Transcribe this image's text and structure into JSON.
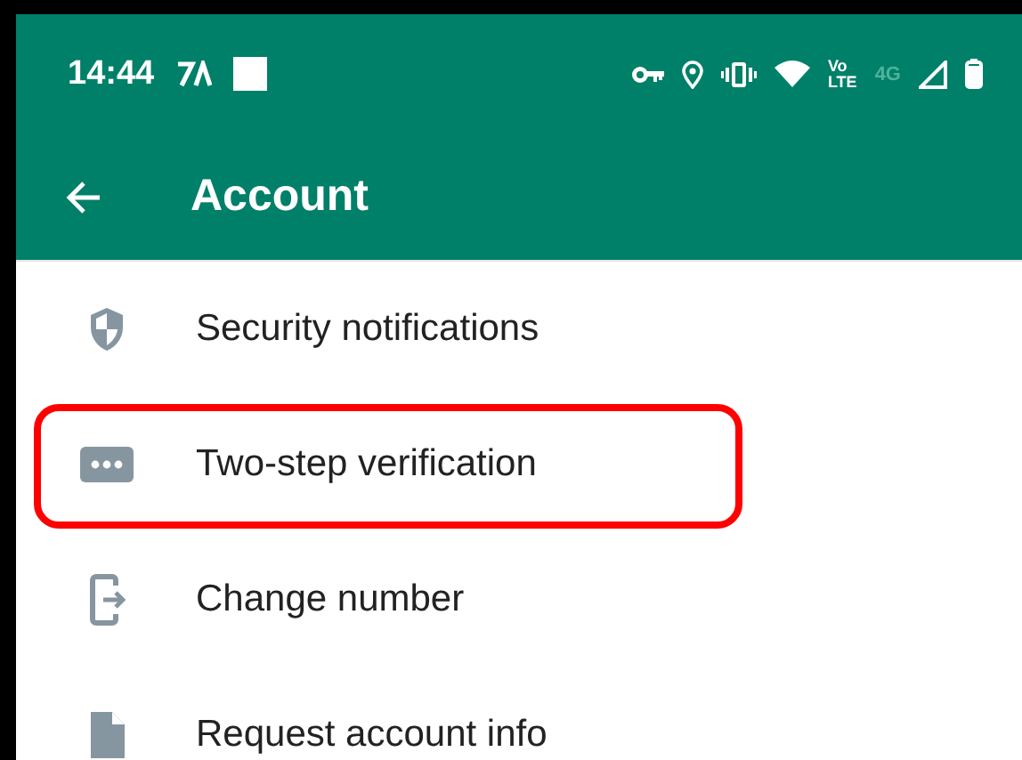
{
  "status_bar": {
    "time": "14:44",
    "volte_top": "Vo",
    "volte_bottom": "LTE",
    "network": "4G"
  },
  "toolbar": {
    "title": "Account"
  },
  "items": [
    {
      "kind": "shield",
      "label": "Security notifications",
      "highlighted": false
    },
    {
      "kind": "dots",
      "label": "Two-step verification",
      "highlighted": true
    },
    {
      "kind": "phone",
      "label": "Change number",
      "highlighted": false
    },
    {
      "kind": "document",
      "label": "Request account info",
      "highlighted": false
    }
  ]
}
